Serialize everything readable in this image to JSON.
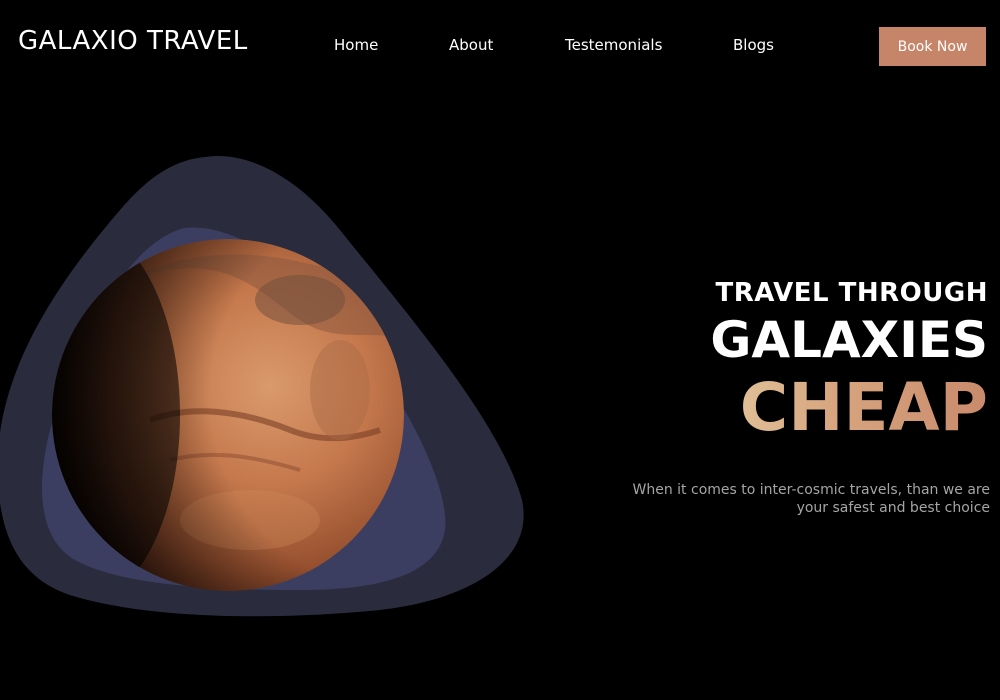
{
  "brand": {
    "name": "GALAXIO TRAVEL"
  },
  "nav": {
    "items": [
      {
        "label": "Home"
      },
      {
        "label": "About"
      },
      {
        "label": "Testemonials"
      },
      {
        "label": "Blogs"
      }
    ],
    "cta_label": "Book Now"
  },
  "hero": {
    "line1": "TRAVEL THROUGH",
    "line2": "GALAXIES",
    "line3": "CHEAP",
    "tagline": "When it comes to inter-cosmic travels, than we  are your safest and best choice",
    "image": "mars-planet"
  },
  "colors": {
    "background": "#000000",
    "cta": "#c68569",
    "accent_gradient_start": "#e3c79e",
    "accent_gradient_end": "#c98a6c",
    "outer_shape": "#2a2b3c",
    "inner_shape": "#3b3e60",
    "planet": "#c27a4f"
  }
}
